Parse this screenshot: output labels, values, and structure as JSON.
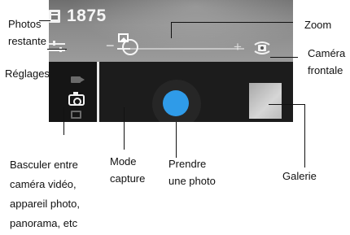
{
  "screen": {
    "photos_remaining": "1875",
    "colors": {
      "shutter": "#2f9be8",
      "bottom_bar": "#1c1c1c",
      "zoom_track": "#f3f3f3"
    },
    "zoom_level": 0.1,
    "icons": {
      "count": "photo-count-icon",
      "settings": "sliders-icon",
      "zoom_out": "minus-icon",
      "zoom_in": "plus-icon",
      "front_camera": "switch-camera-icon",
      "video": "video-camera-icon",
      "photo": "camera-icon",
      "panorama": "panorama-icon",
      "capture_mode": "image-icon"
    },
    "zoom_minus": "−",
    "zoom_plus": "+"
  },
  "annotations": {
    "photos_left": {
      "line1": "Photos",
      "line2": "restante"
    },
    "settings": "Réglages",
    "zoom": "Zoom",
    "front_camera": {
      "line1": "Caméra",
      "line2": "frontale"
    },
    "switch_mode": {
      "line1": "Basculer entre",
      "line2": "caméra vidéo,",
      "line3": "appareil photo,",
      "line4": "panorama, etc"
    },
    "capture_mode": {
      "line1": "Mode",
      "line2": "capture"
    },
    "take_photo": {
      "line1": "Prendre",
      "line2": "une photo"
    },
    "gallery": "Galerie"
  }
}
